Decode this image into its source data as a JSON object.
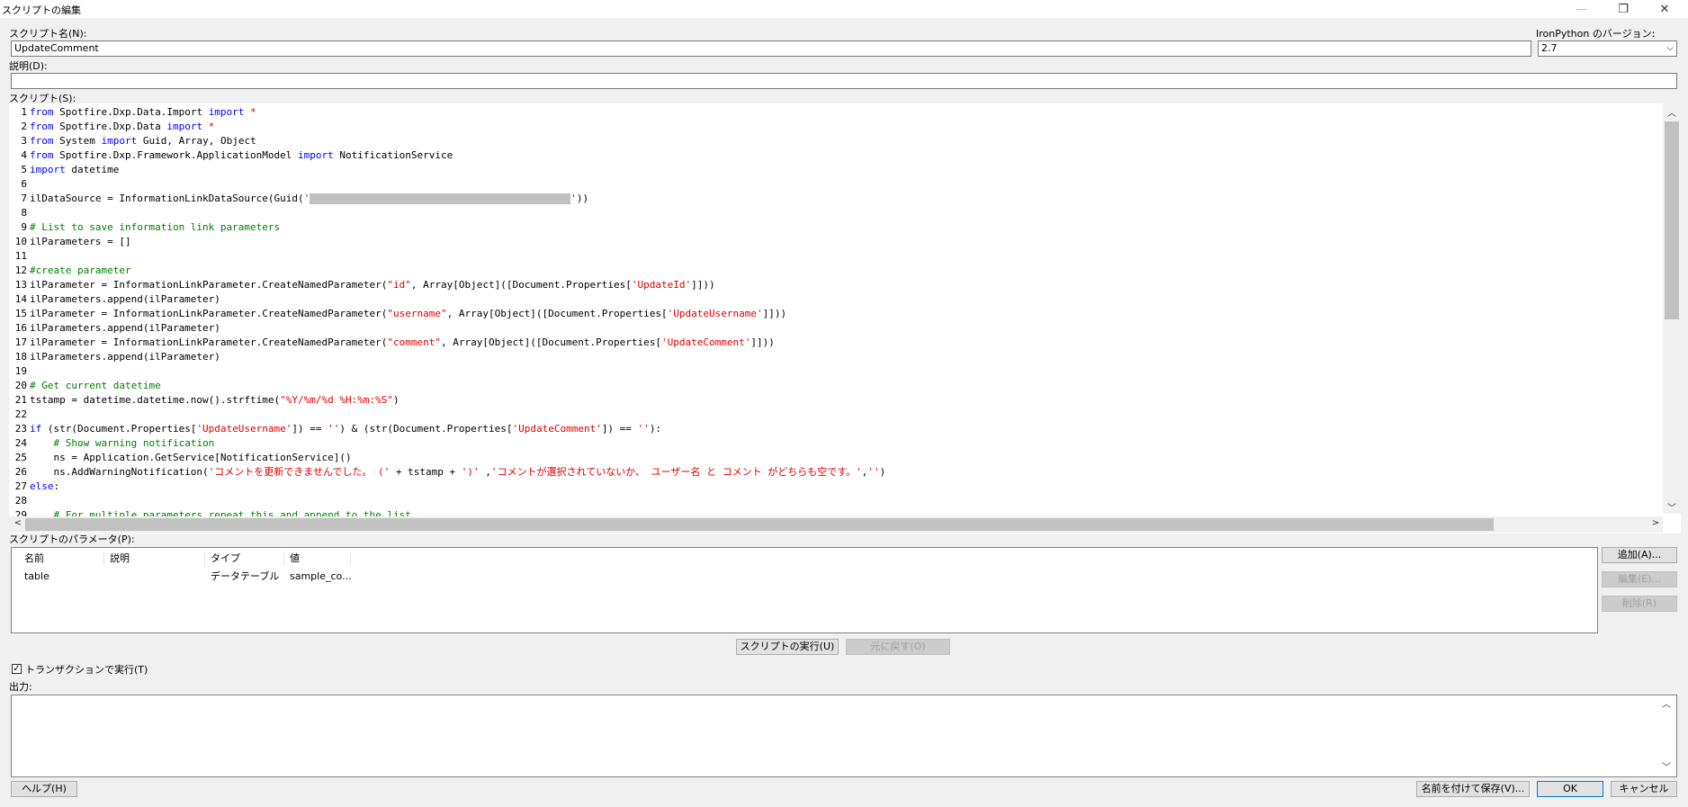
{
  "window": {
    "title": "スクリプトの編集",
    "minimize_icon": "—",
    "restore_icon": "❐",
    "close_icon": "✕"
  },
  "script_name": {
    "label": "スクリプト名(N):",
    "value": "UpdateComment"
  },
  "ironpython": {
    "label": "IronPython のバージョン:",
    "value": "2.7"
  },
  "description": {
    "label": "説明(D):",
    "value": ""
  },
  "script": {
    "label": "スクリプト(S):",
    "lines": [
      "from Spotfire.Dxp.Data.Import import *",
      "from Spotfire.Dxp.Data import *",
      "from System import Guid, Array, Object",
      "from Spotfire.Dxp.Framework.ApplicationModel import NotificationService",
      "import datetime",
      "",
      "ilDataSource = InformationLinkDataSource(Guid('[redacted]'))",
      "",
      "# List to save information link parameters",
      "ilParameters = []",
      "",
      "#create parameter",
      "ilParameter = InformationLinkParameter.CreateNamedParameter(\"id\", Array[Object]([Document.Properties['UpdateId']]))",
      "ilParameters.append(ilParameter)",
      "ilParameter = InformationLinkParameter.CreateNamedParameter(\"username\", Array[Object]([Document.Properties['UpdateUsername']]))",
      "ilParameters.append(ilParameter)",
      "ilParameter = InformationLinkParameter.CreateNamedParameter(\"comment\", Array[Object]([Document.Properties['UpdateComment']]))",
      "ilParameters.append(ilParameter)",
      "",
      "# Get current datetime",
      "tstamp = datetime.datetime.now().strftime(\"%Y/%m/%d %H:%m:%S\")",
      "",
      "if (str(Document.Properties['UpdateUsername']) == '') & (str(Document.Properties['UpdateComment']) == ''):",
      "    # Show warning notification",
      "    ns = Application.GetService[NotificationService]()",
      "    ns.AddWarningNotification('コメントを更新できませんでした。 (' + tstamp + ')' ,'コメントが選択されていないか、 ユーザー名 と コメント がどちらも空です。','')",
      "else:",
      "",
      "    # For multiple parameters repeat this and append to the list"
    ]
  },
  "scroll": {
    "up": "︿",
    "down": "﹀",
    "left": "<",
    "right": ">"
  },
  "params": {
    "label": "スクリプトのパラメータ(P):",
    "columns": [
      "名前",
      "説明",
      "タイプ",
      "値"
    ],
    "rows": [
      {
        "name": "table",
        "desc": "",
        "type": "データテーブル",
        "value": "sample_co..."
      }
    ]
  },
  "buttons": {
    "add": "追加(A)...",
    "edit": "編集(E)...",
    "delete": "削除(R)",
    "run": "スクリプトの実行(U)",
    "undo": "元に戻す(O)",
    "help": "ヘルプ(H)",
    "save_as": "名前を付けて保存(V)...",
    "ok": "OK",
    "cancel": "キャンセル"
  },
  "transaction": {
    "label": "トランザクションで実行(T)",
    "checked": true,
    "mark": "✓"
  },
  "output": {
    "label": "出力:"
  }
}
